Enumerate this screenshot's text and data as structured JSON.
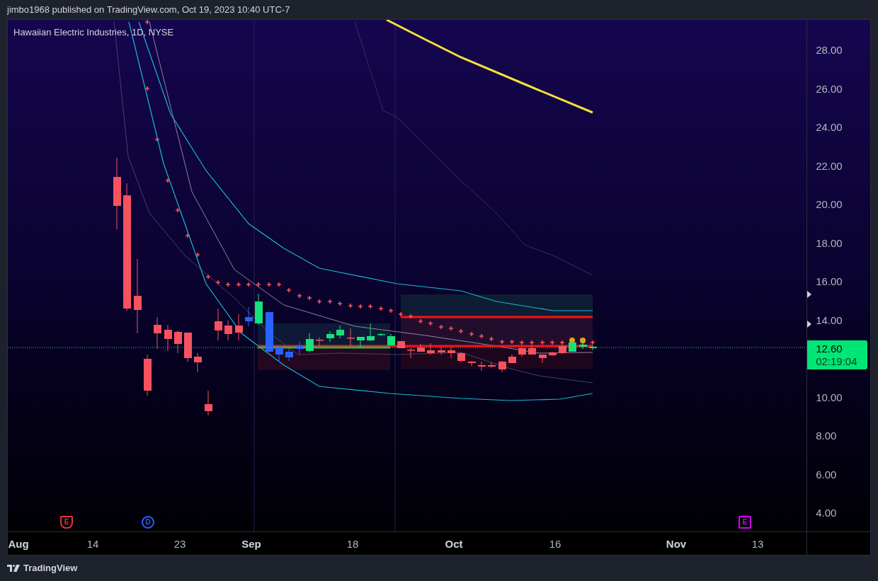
{
  "header": {
    "publisher_line": "jimbo1968 published on TradingView.com, Oct 19, 2023 10:40 UTC-7"
  },
  "chart": {
    "symbol_legend": "Hawaiian Electric Industries, 1D, NYSE",
    "price_ticks": [
      "28.00",
      "26.00",
      "24.00",
      "22.00",
      "20.00",
      "18.00",
      "16.00",
      "14.00",
      "10.00",
      "8.00",
      "6.00",
      "4.00"
    ],
    "current_price": {
      "price": "12.60",
      "countdown": "02:19:04"
    },
    "time_labels": [
      {
        "label": "Aug",
        "kind": "month"
      },
      {
        "label": "14",
        "kind": "day"
      },
      {
        "label": "23",
        "kind": "day"
      },
      {
        "label": "Sep",
        "kind": "month"
      },
      {
        "label": "18",
        "kind": "day"
      },
      {
        "label": "Oct",
        "kind": "month"
      },
      {
        "label": "16",
        "kind": "day"
      },
      {
        "label": "Nov",
        "kind": "month"
      },
      {
        "label": "13",
        "kind": "day"
      }
    ],
    "events": [
      {
        "letter": "E",
        "kind": "shield",
        "color": "#e0343f"
      },
      {
        "letter": "D",
        "kind": "circle",
        "color": "#2962ff"
      },
      {
        "letter": "E",
        "kind": "square",
        "color": "#d500f9"
      }
    ]
  },
  "footer": {
    "brand": "TradingView"
  }
}
